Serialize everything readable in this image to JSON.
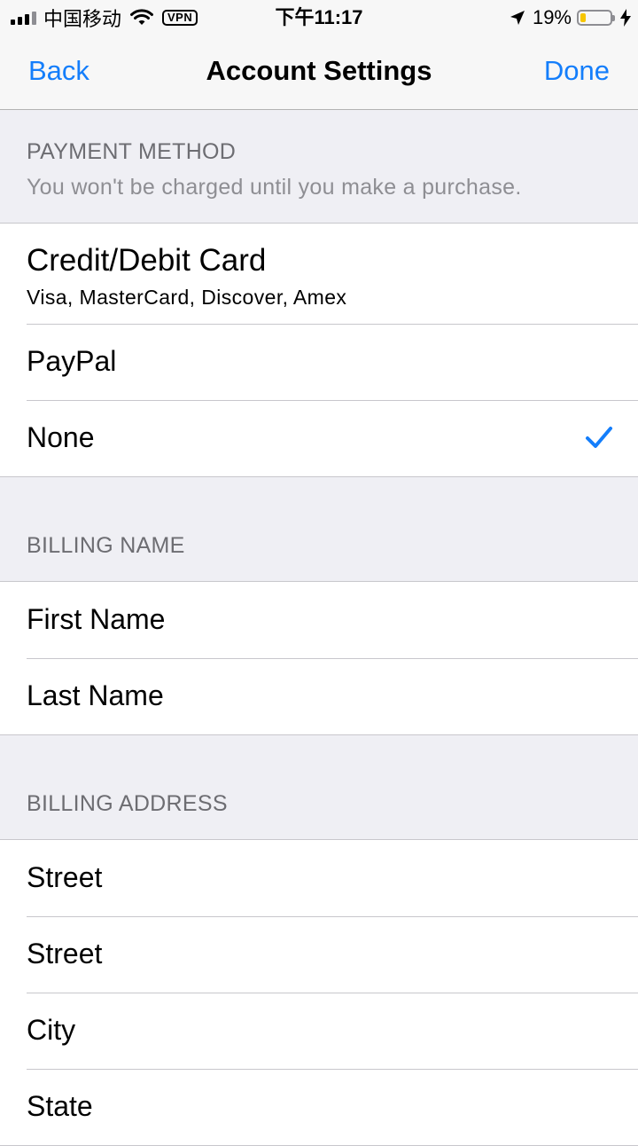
{
  "status_bar": {
    "carrier": "中国移动",
    "vpn": "VPN",
    "time": "下午11:17",
    "battery_text": "19%",
    "battery_level": 0.19,
    "battery_color": "#f7c600"
  },
  "nav": {
    "back_label": "Back",
    "title": "Account Settings",
    "done_label": "Done"
  },
  "payment": {
    "header": "PAYMENT METHOD",
    "subheader": "You won't be charged until you make a purchase.",
    "options": [
      {
        "label": "Credit/Debit Card",
        "detail": "Visa, MasterCard, Discover, Amex"
      },
      {
        "label": "PayPal"
      },
      {
        "label": "None",
        "selected": true
      }
    ]
  },
  "billing_name": {
    "header": "BILLING NAME",
    "fields": [
      "First Name",
      "Last Name"
    ]
  },
  "billing_address": {
    "header": "BILLING ADDRESS",
    "fields": [
      "Street",
      "Street",
      "City",
      "State"
    ]
  },
  "colors": {
    "accent": "#147efb",
    "background": "#efeff4"
  }
}
